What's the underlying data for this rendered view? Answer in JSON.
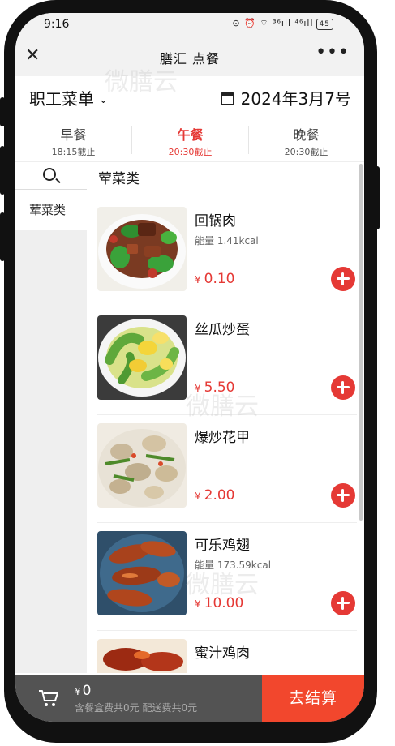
{
  "status": {
    "time": "9:16",
    "indicators": "⊙ ⏰ ⌔ ³⁶ıll ⁴⁶ıll",
    "battery": "45"
  },
  "nav": {
    "title": "膳汇 点餐",
    "close": "✕",
    "more": "•••"
  },
  "menu": {
    "selected": "职工菜单",
    "date": "2024年3月7号"
  },
  "meals": [
    {
      "name": "早餐",
      "cutoff": "18:15截止"
    },
    {
      "name": "午餐",
      "cutoff": "20:30截止"
    },
    {
      "name": "晚餐",
      "cutoff": "20:30截止"
    }
  ],
  "active_meal": "午餐",
  "sidebar": {
    "categories": [
      "荤菜类"
    ]
  },
  "section": {
    "title": "荤菜类"
  },
  "dishes": [
    {
      "name": "回锅肉",
      "kcal": "能量 1.41kcal",
      "price": "0.10"
    },
    {
      "name": "丝瓜炒蛋",
      "kcal": "",
      "price": "5.50"
    },
    {
      "name": "爆炒花甲",
      "kcal": "",
      "price": "2.00"
    },
    {
      "name": "可乐鸡翅",
      "kcal": "能量 173.59kcal",
      "price": "10.00"
    },
    {
      "name": "蜜汁鸡肉",
      "kcal": "",
      "price": ""
    }
  ],
  "currency": "¥",
  "cart": {
    "total": "0",
    "fees": "含餐盒费共0元 配送费共0元",
    "checkout": "去结算"
  },
  "watermark": "微膳云",
  "colors": {
    "accent": "#e53935",
    "checkout": "#f2472d",
    "cartbar": "#535353"
  }
}
